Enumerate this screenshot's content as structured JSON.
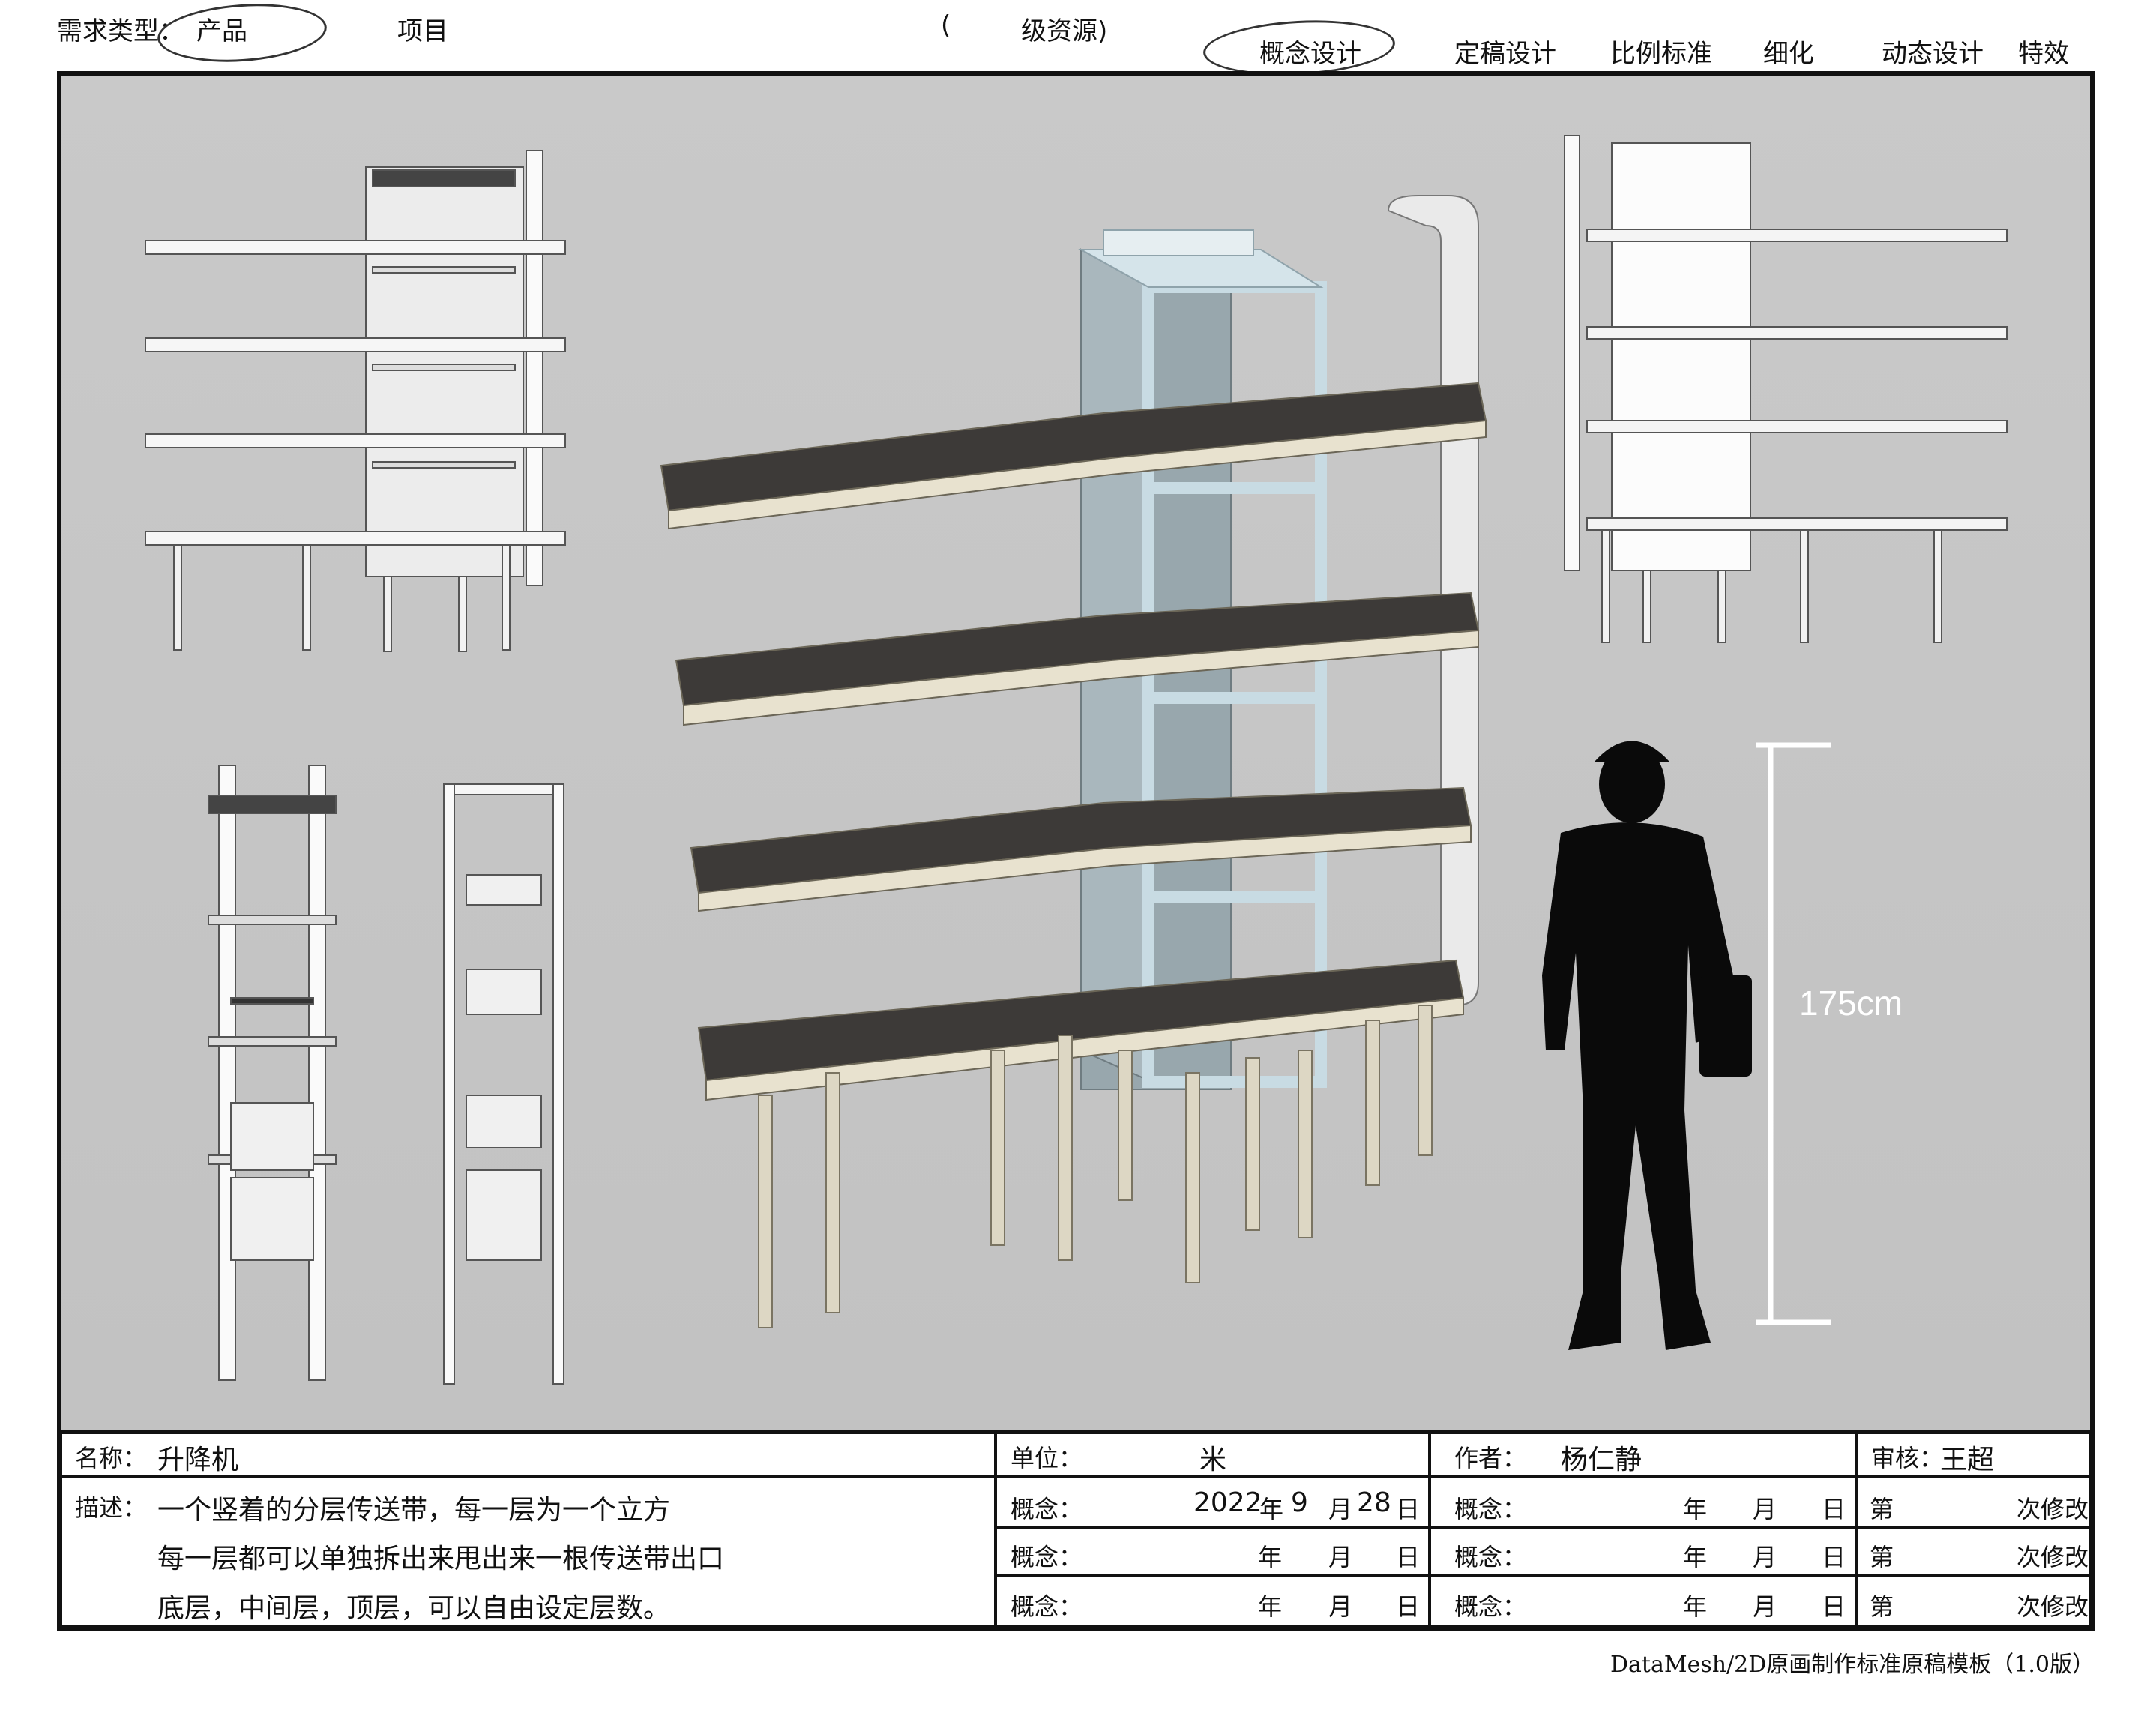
{
  "header": {
    "demand_type_label": "需求类型：",
    "demand_product": "产品",
    "demand_project": "项目",
    "level_open": "(",
    "level_resource": "级资源)",
    "stages": [
      "概念设计",
      "定稿设计",
      "比例标准",
      "细化",
      "动态设计",
      "特效"
    ]
  },
  "illustration": {
    "height_label": "175cm"
  },
  "info": {
    "name_label": "名称：",
    "name_value": "升降机",
    "unit_label": "单位：",
    "unit_value": "米",
    "author_label": "作者：",
    "author_value": "杨仁静",
    "review_label": "审核：",
    "review_value": "王超",
    "desc_label": "描述：",
    "desc_lines": [
      "一个竖着的分层传送带，每一层为一个立方",
      "每一层都可以单独拆出来甩出来一根传送带出口",
      "底层，中间层，顶层，可以自由设定层数。"
    ],
    "concept_label": "概念：",
    "date_year": "2022",
    "date_month": "9",
    "date_day": "28",
    "year_char": "年",
    "month_char": "月",
    "day_char": "日",
    "rev_prefix": "第",
    "rev_suffix": "次修改"
  },
  "footer": "DataMesh/2D原画制作标准原稿模板（1.0版）"
}
